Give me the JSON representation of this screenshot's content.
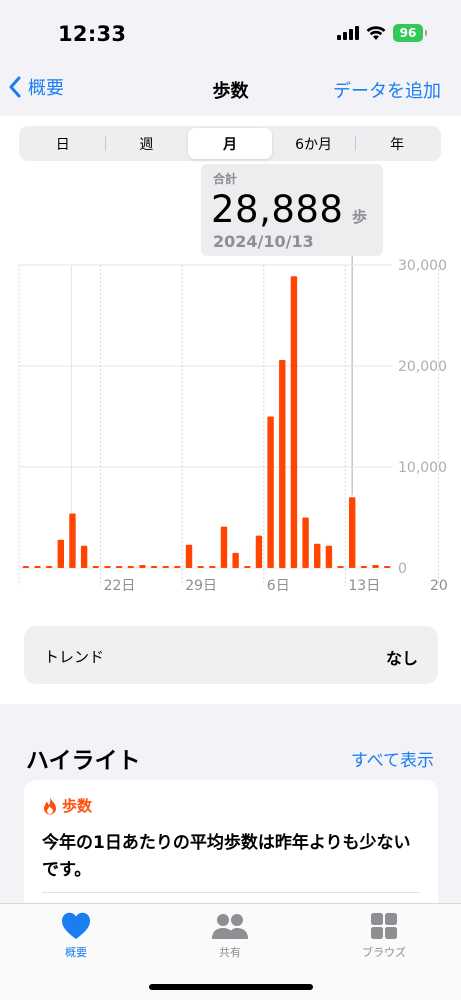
{
  "status_bar": {
    "time": "12:33",
    "battery": "96"
  },
  "nav": {
    "back_label": "概要",
    "title": "歩数",
    "action_label": "データを追加"
  },
  "segments": [
    {
      "label": "日",
      "active": false
    },
    {
      "label": "週",
      "active": false
    },
    {
      "label": "月",
      "active": true
    },
    {
      "label": "6か月",
      "active": false
    },
    {
      "label": "年",
      "active": false
    }
  ],
  "tooltip": {
    "label": "合計",
    "value": "28,888",
    "unit": "歩",
    "date": "2024/10/13"
  },
  "chart_data": {
    "type": "bar",
    "categories": [
      "9/15",
      "9/16",
      "9/17",
      "9/18",
      "9/19",
      "9/20",
      "9/21",
      "9/22",
      "9/23",
      "9/24",
      "9/25",
      "9/26",
      "9/27",
      "9/28",
      "9/29",
      "9/30",
      "10/1",
      "10/2",
      "10/3",
      "10/4",
      "10/5",
      "10/6",
      "10/7",
      "10/8",
      "10/9",
      "10/10",
      "10/11",
      "10/12",
      "10/13",
      "10/14",
      "10/15",
      "10/16",
      "10/17",
      "10/18",
      "10/19",
      "10/20"
    ],
    "values": [
      0,
      200,
      200,
      2800,
      5400,
      2200,
      100,
      100,
      100,
      100,
      300,
      100,
      100,
      100,
      2300,
      100,
      100,
      4100,
      1500,
      100,
      3200,
      15000,
      20600,
      28888,
      5000,
      2400,
      2200,
      200,
      7000,
      100,
      300,
      0
    ],
    "x_tick_labels": [
      "22日",
      "29日",
      "6日",
      "13日",
      "20"
    ],
    "ylim": [
      0,
      30000
    ],
    "y_tick_labels": [
      "0",
      "10,000",
      "20,000",
      "30,000"
    ],
    "highlighted": "10/13",
    "bar_color": "#ff4500",
    "grid": true
  },
  "trend": {
    "label": "トレンド",
    "value": "なし"
  },
  "highlights": {
    "title": "ハイライト",
    "see_all": "すべて表示",
    "card": {
      "category": "歩数",
      "text": "今年の1日あたりの平均歩数は昨年よりも少ないです。"
    }
  },
  "tab_bar": [
    {
      "label": "概要",
      "icon": "heart-icon",
      "active": true
    },
    {
      "label": "共有",
      "icon": "people-icon",
      "active": false
    },
    {
      "label": "ブラウズ",
      "icon": "grid-icon",
      "active": false
    }
  ]
}
